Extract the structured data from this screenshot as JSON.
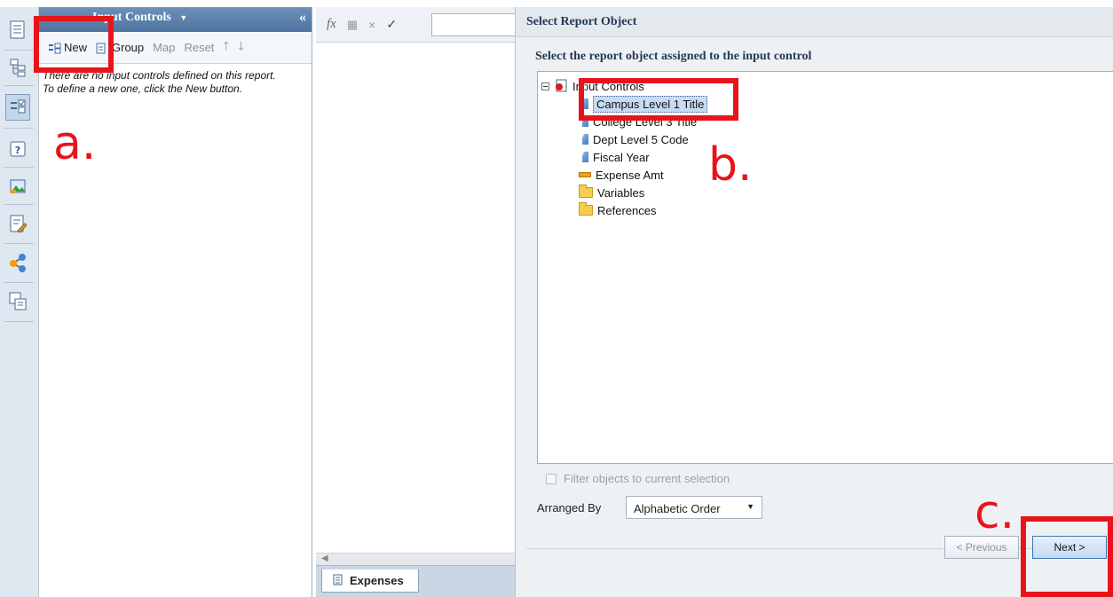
{
  "input_controls_panel": {
    "title": "Input Controls",
    "toolbar": {
      "new_label": "New",
      "group_label": "Group",
      "map_label": "Map",
      "reset_label": "Reset"
    },
    "empty_message_line1": "There are no input controls defined on this report.",
    "empty_message_line2": "To define a new one, click the New button."
  },
  "report": {
    "tab_label": "Expenses"
  },
  "dialog": {
    "title": "Select Report Object",
    "subtitle": "Select the report object assigned to the input control",
    "tree": {
      "root_label": "Input Controls",
      "items": [
        {
          "label": "Campus Level 1 Title",
          "icon": "dimension-icon",
          "selected": true
        },
        {
          "label": "College Level 3 Title",
          "icon": "dimension-icon"
        },
        {
          "label": "Dept Level 5 Code",
          "icon": "dimension-icon"
        },
        {
          "label": "Fiscal Year",
          "icon": "dimension-icon"
        },
        {
          "label": "Expense Amt",
          "icon": "measure-icon"
        },
        {
          "label": "Variables",
          "icon": "folder-icon"
        },
        {
          "label": "References",
          "icon": "folder-icon"
        }
      ]
    },
    "filter_label": "Filter objects to current selection",
    "arranged_by_label": "Arranged By",
    "arranged_by_value": "Alphabetic Order",
    "previous_label": "< Previous",
    "next_label": "Next >"
  },
  "annotations": {
    "a": "a.",
    "b": "b.",
    "c": "c."
  },
  "colors": {
    "annotation_red": "#e8141b",
    "header_blue": "#5a80ab",
    "selection_blue": "#c7dcf4"
  }
}
